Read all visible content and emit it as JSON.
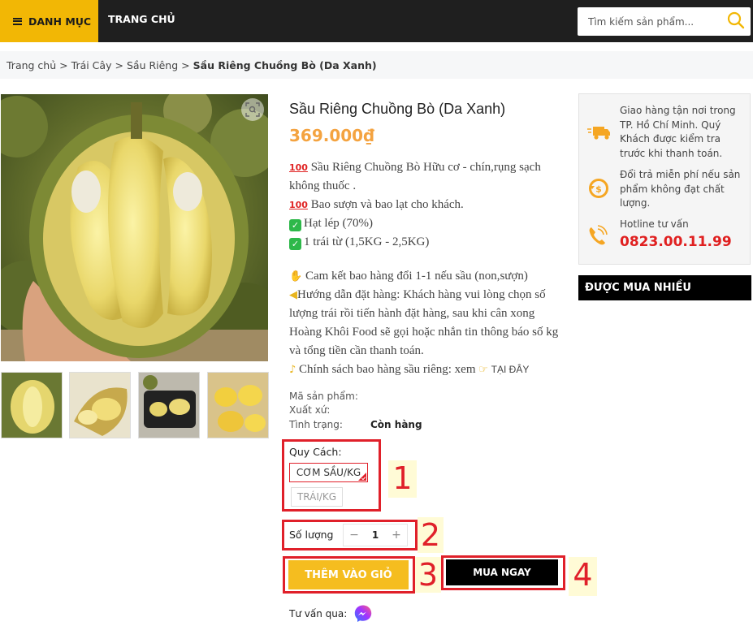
{
  "header": {
    "menu_label": "DANH MỤC",
    "home_label": "TRANG CHỦ",
    "search_placeholder": "Tìm kiếm sản phẩm..."
  },
  "breadcrumb": {
    "items": [
      "Trang chủ",
      "Trái Cây",
      "Sầu Riêng"
    ],
    "separator": ">",
    "current": "Sầu Riêng Chuồng Bò (Da Xanh)"
  },
  "product": {
    "title": "Sầu Riêng Chuồng Bò (Da Xanh)",
    "price": "369.000₫",
    "description": [
      "Sầu Riêng Chuồng Bò Hữu cơ - chín,rụng sạch không thuốc .",
      "Bao sượn và bao lạt cho khách.",
      "Hạt lép (70%)",
      "1 trái từ (1,5KG - 2,5KG)"
    ],
    "commitment": "Cam kết bao hàng đổi 1-1 nếu sầu (non,sượn)",
    "guide": "Hướng dẫn đặt hàng: Khách hàng vui lòng chọn số lượng trái rồi tiến hành đặt hàng, sau khi cân xong Hoàng Khôi Food sẽ gọi hoặc nhắn tin thông báo số kg và tổng tiền cần thanh toán.",
    "policy_text": "Chính sách bao hàng sầu riêng: xem",
    "policy_link": "TẠI ĐÂY",
    "meta": {
      "sku_label": "Mã sản phẩm:",
      "origin_label": "Xuất xứ:",
      "status_label": "Tình trạng:",
      "status_value": "Còn hàng"
    },
    "variant_label": "Quy Cách:",
    "variants": [
      "CƠM SẦU/KG",
      "TRÁI/KG"
    ],
    "quantity_label": "Số lượng",
    "quantity_minus": "−",
    "quantity_value": "1",
    "quantity_plus": "+",
    "add_to_cart": "THÊM VÀO GIỎ",
    "buy_now": "MUA NGAY",
    "consult_label": "Tư vấn qua:"
  },
  "annotations": [
    "1",
    "2",
    "3",
    "4"
  ],
  "sidebar": {
    "shipping": "Giao hàng tận nơi trong TP. Hồ Chí Minh. Quý Khách được kiểm tra trước khi thanh toán.",
    "returns": "Đổi trả miễn phí nếu sản phẩm không đạt chất lượng.",
    "hotline_label": "Hotline tư vấn",
    "hotline_number": "0823.00.11.99",
    "best_seller_title": "ĐƯỢC MUA NHIỀU"
  },
  "colors": {
    "accent_yellow": "#f2b705",
    "price_orange": "#f4a340",
    "annotation_red": "#e0202a",
    "hotline_red": "#e02020"
  }
}
